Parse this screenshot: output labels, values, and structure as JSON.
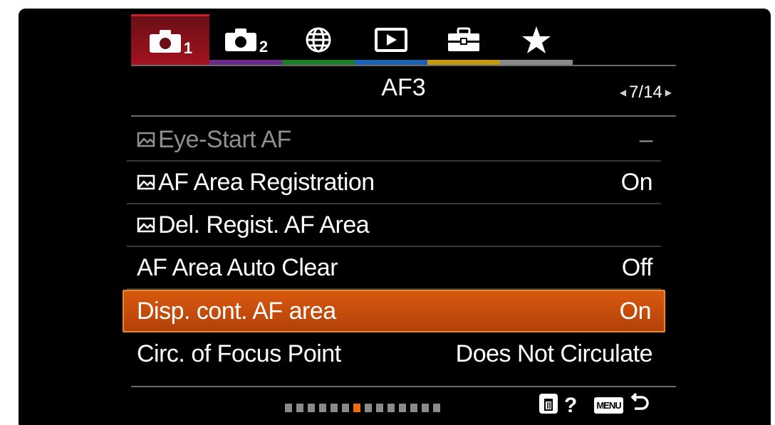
{
  "tabs": [
    {
      "name": "shooting-1",
      "icon": "camera-icon",
      "sub": "1",
      "color": "#a3131f",
      "active": true
    },
    {
      "name": "shooting-2",
      "icon": "camera-icon",
      "sub": "2",
      "color": "#6a2a8a",
      "active": false
    },
    {
      "name": "network",
      "icon": "globe-icon",
      "sub": "",
      "color": "#1f7a2a",
      "active": false
    },
    {
      "name": "playback",
      "icon": "play-icon",
      "sub": "",
      "color": "#1d5fb0",
      "active": false
    },
    {
      "name": "setup",
      "icon": "toolbox-icon",
      "sub": "",
      "color": "#c49a12",
      "active": false
    },
    {
      "name": "my-menu",
      "icon": "star-icon",
      "sub": "",
      "color": "#8a8a8a",
      "active": false
    }
  ],
  "header": {
    "title": "AF3",
    "page": "7/14"
  },
  "items": [
    {
      "label": "Eye-Start AF",
      "value": "–",
      "af_icon": true,
      "dim": true,
      "selected": false
    },
    {
      "label": "AF Area Registration",
      "value": "On",
      "af_icon": true,
      "dim": false,
      "selected": false
    },
    {
      "label": "Del. Regist. AF Area",
      "value": "",
      "af_icon": true,
      "dim": false,
      "selected": false
    },
    {
      "label": "AF Area Auto Clear",
      "value": "Off",
      "af_icon": false,
      "dim": false,
      "selected": false
    },
    {
      "label": "Disp. cont. AF area",
      "value": "On",
      "af_icon": false,
      "dim": false,
      "selected": true
    },
    {
      "label": "Circ. of Focus Point",
      "value": "Does Not Circulate",
      "af_icon": false,
      "dim": false,
      "selected": false
    }
  ],
  "footer": {
    "pager_total": 14,
    "pager_current": 7,
    "help_label": "?",
    "menu_label": "MENU",
    "icons": [
      "trash-icon",
      "back-arrow-icon"
    ]
  },
  "colors": {
    "selection": "#d8590e",
    "pager_active": "#f26a0f",
    "background": "#000000"
  }
}
